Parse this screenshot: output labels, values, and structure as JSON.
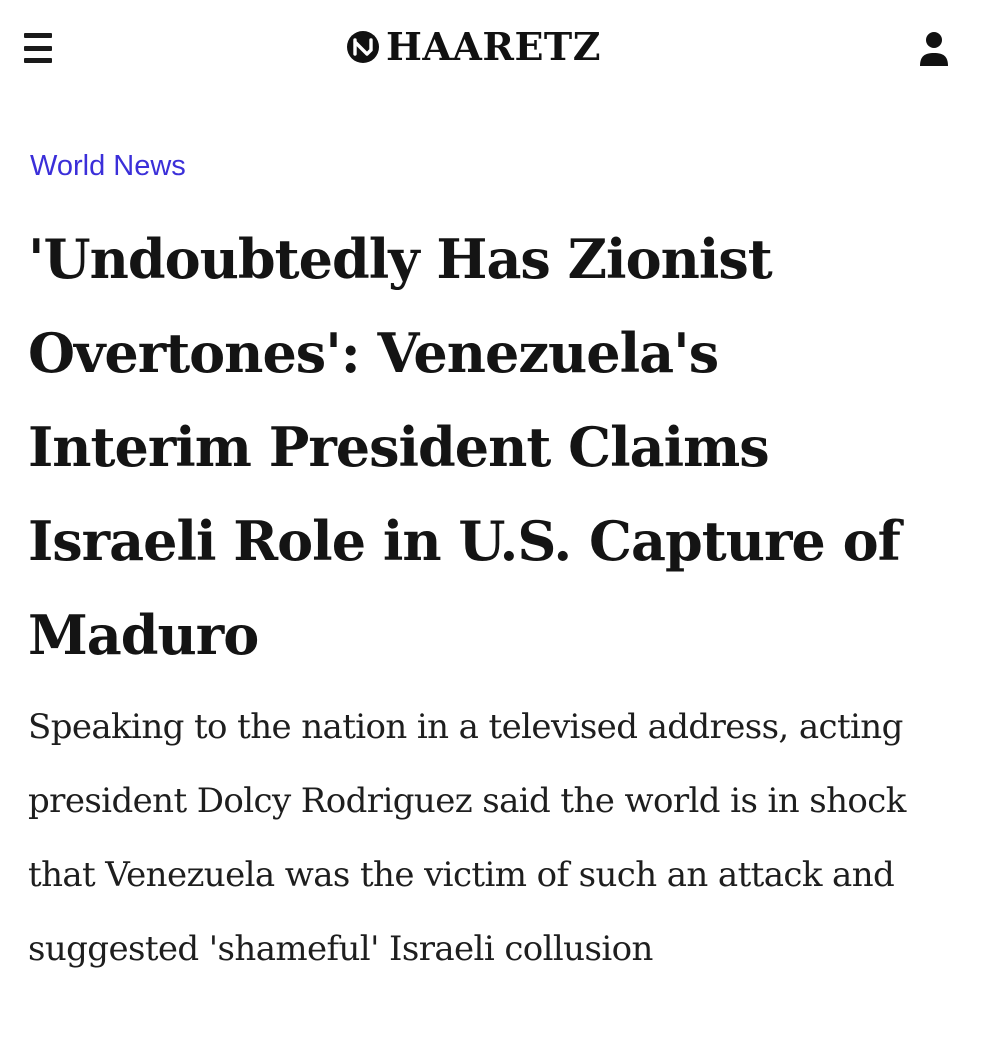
{
  "header": {
    "brand": "HAARETZ",
    "menu_icon": "hamburger-menu-icon",
    "account_icon": "user-account-icon",
    "logo_icon": "haaretz-logo-mark"
  },
  "article": {
    "section": "World News",
    "headline": "'Undoubtedly Has Zionist Overtones': Venezuela's Interim President Claims Israeli Role in U.S. Capture of Maduro",
    "dek": "Speaking to the nation in a televised address, acting president Dolcy Rodriguez said the world is in shock that Venezuela was the victim of such an attack and suggested 'shameful' Israeli collusion"
  },
  "colors": {
    "section_link": "#3b2fd9",
    "text": "#141414",
    "background": "#ffffff"
  }
}
